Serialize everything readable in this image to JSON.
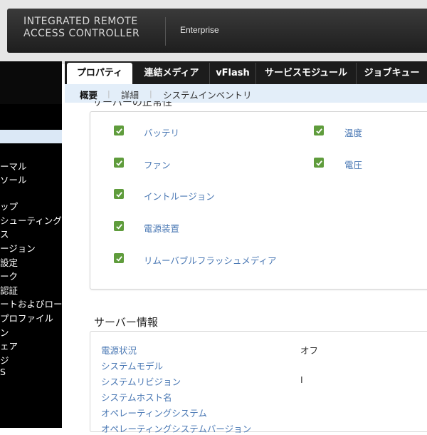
{
  "header": {
    "product_name": "INTEGRATED REMOTE\nACCESS CONTROLLER",
    "edition": "Enterprise"
  },
  "sidebar": {
    "items": [
      {
        "label": "ーマル"
      },
      {
        "label": "ソール"
      },
      {
        "label": "ップ"
      },
      {
        "label": "シューティング"
      },
      {
        "label": "ス"
      },
      {
        "label": "ージョン"
      },
      {
        "label": "設定"
      },
      {
        "label": "ーク"
      },
      {
        "label": "認証"
      },
      {
        "label": "ートおよびロー"
      },
      {
        "label": "プロファイル"
      },
      {
        "label": "ン"
      },
      {
        "label": "ェア"
      },
      {
        "label": "ジ"
      },
      {
        "label": "S"
      }
    ]
  },
  "tabs": [
    {
      "label": "プロパティ",
      "active": true
    },
    {
      "label": "連結メディア"
    },
    {
      "label": "vFlash"
    },
    {
      "label": "サービスモジュール"
    },
    {
      "label": "ジョブキュー"
    }
  ],
  "subtabs": [
    {
      "label": "概要",
      "active": true
    },
    {
      "label": "詳細"
    },
    {
      "label": "システムインベントリ"
    }
  ],
  "health_section": {
    "title": "サーバーの正常性",
    "components": [
      {
        "label": "バッテリ",
        "status": "ok"
      },
      {
        "label": "温度",
        "status": "ok"
      },
      {
        "label": "ファン",
        "status": "ok"
      },
      {
        "label": "電圧",
        "status": "ok"
      },
      {
        "label": "イントルージョン",
        "status": "ok"
      },
      {
        "label": "電源装置",
        "status": "ok"
      },
      {
        "label": "リムーバブルフラッシュメディア",
        "status": "ok"
      }
    ]
  },
  "server_info": {
    "title": "サーバー情報",
    "rows": [
      {
        "key": "電源状況",
        "value": "オフ"
      },
      {
        "key": "システムモデル",
        "value": ""
      },
      {
        "key": "システムリビジョン",
        "value": "I"
      },
      {
        "key": "システムホスト名",
        "value": ""
      },
      {
        "key": "オペレーティングシステム",
        "value": ""
      },
      {
        "key": "オペレーティングシステムバージョン",
        "value": ""
      }
    ]
  },
  "colors": {
    "header_bg": "#262626",
    "accent_link": "#4a78b4",
    "check_green": "#5f9c3c",
    "subtab_bg": "#e3eef9"
  }
}
